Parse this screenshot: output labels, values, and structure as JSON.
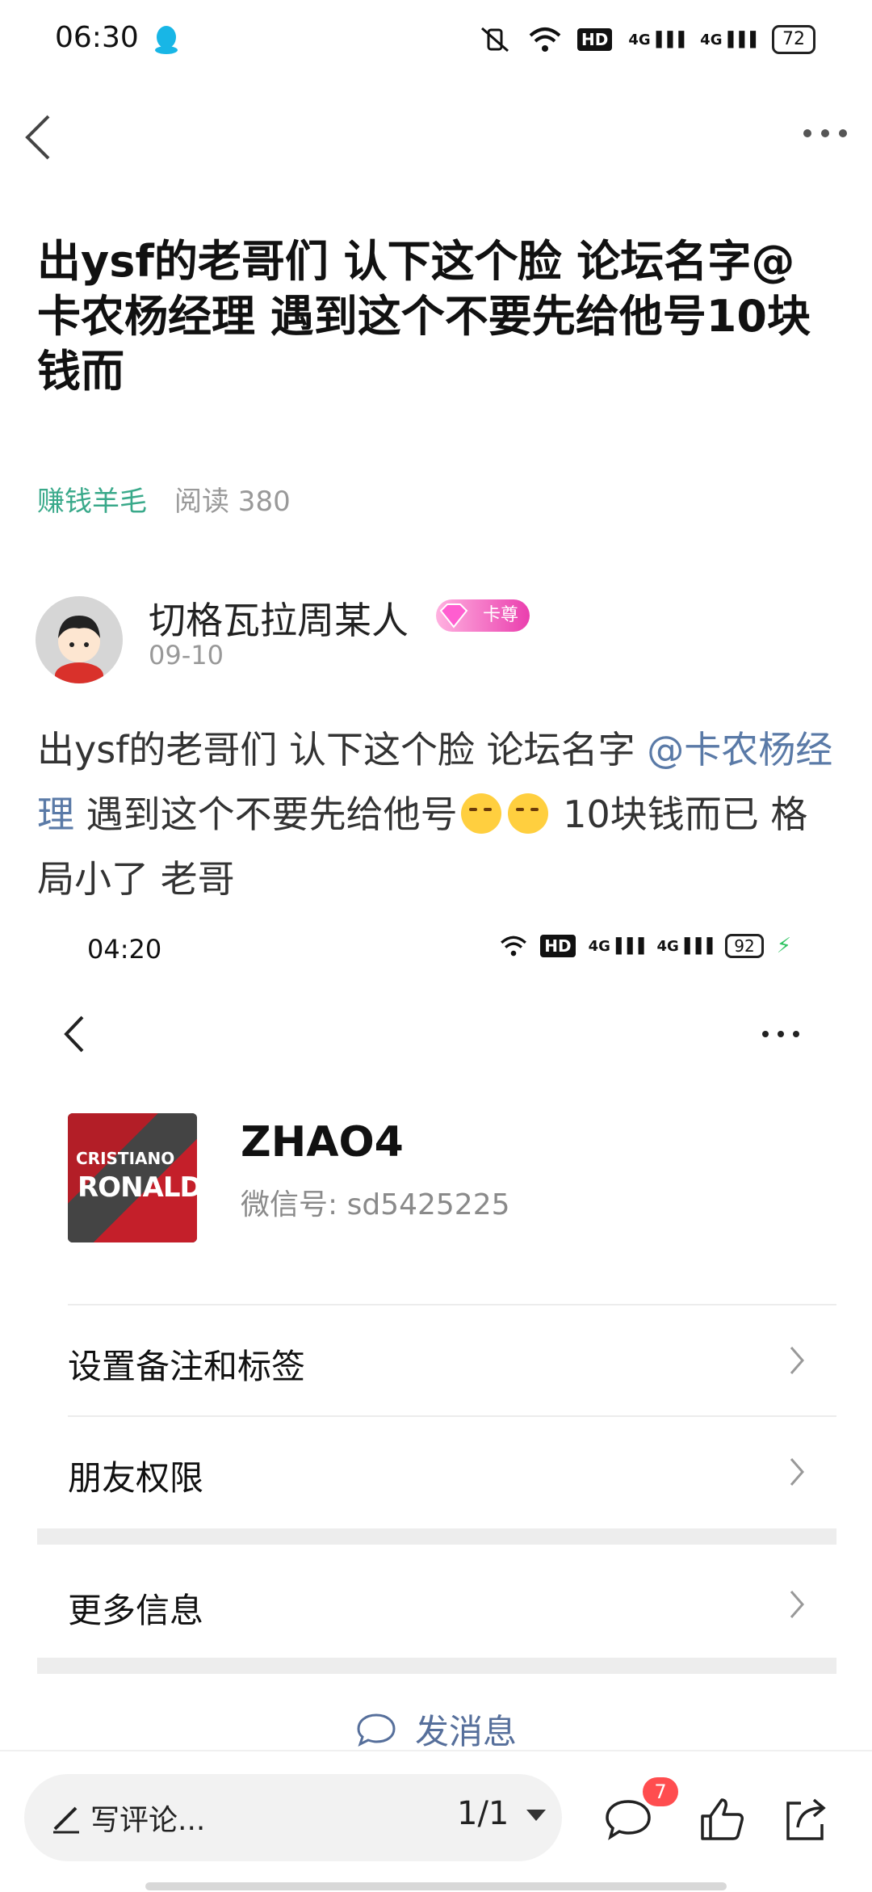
{
  "status_bar": {
    "time": "06:30",
    "battery": "72"
  },
  "post": {
    "title": "出ysf的老哥们 认下这个脸 论坛名字@卡农杨经理 遇到这个不要先给他号10块钱而",
    "category": "赚钱羊毛",
    "reads": "阅读 380",
    "author": {
      "name": "切格瓦拉周某人",
      "badge": "卡尊",
      "date": "09-10"
    },
    "content": {
      "part1": "出ysf的老哥们 认下这个脸  论坛名字 ",
      "mention": "@卡农杨经理",
      "part2": "  遇到这个不要先给他号",
      "part3": " 10块钱而已 格局小了 老哥"
    }
  },
  "embedded_screenshot": {
    "status_bar": {
      "time": "04:20",
      "battery": "92"
    },
    "contact": {
      "avatar_text_1": "CRISTIANO",
      "avatar_text_2": "RONALDO",
      "name": "ZHAO4",
      "wechat_id": "微信号: sd5425225"
    },
    "rows": [
      {
        "label": "设置备注和标签"
      },
      {
        "label": "朋友权限"
      },
      {
        "label": "更多信息"
      }
    ],
    "send_message": "发消息"
  },
  "bottom_bar": {
    "comment_placeholder": "写评论...",
    "pager": "1/1",
    "comment_count": "7"
  },
  "colors": {
    "category": "#39a98a",
    "mention": "#5a7aa7",
    "badge": "#ea3fae",
    "count_badge": "#ff4d4f"
  }
}
